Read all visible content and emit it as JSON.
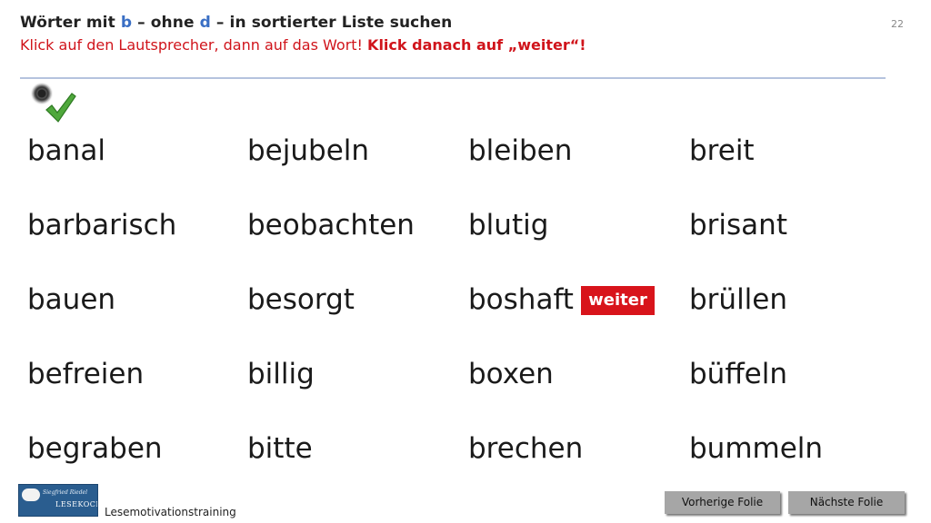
{
  "header": {
    "title_1": "Wörter mit ",
    "title_b": "b",
    "title_2": " – ohne ",
    "title_d": "d",
    "title_3": " – in sortierter Liste suchen",
    "instruction": "Klick auf den Lautsprecher, dann auf das Wort! ",
    "instruction_bold": "Klick danach auf „weiter“!",
    "page_number": "22"
  },
  "icons": {
    "speaker": "speaker-icon",
    "check": "checkmark-icon"
  },
  "words": {
    "c1": [
      "banal",
      "barbarisch",
      "bauen",
      "befreien",
      "begraben"
    ],
    "c2": [
      "bejubeln",
      "beobachten",
      "besorgt",
      "billig",
      "bitte"
    ],
    "c3": [
      "bleiben",
      "blutig",
      "boshaft",
      "boxen",
      "brechen"
    ],
    "c4": [
      "breit",
      "brisant",
      "brüllen",
      "büffeln",
      "bummeln"
    ]
  },
  "weiter_label": "weiter",
  "footer": {
    "logo_line1": "Siegfried Riedel",
    "logo_line2": "LESEKOCH",
    "label": "Lesemotivationstraining",
    "prev_label": "Vorherige  Folie",
    "next_label": "Nächste  Folie"
  },
  "colors": {
    "title_blue": "#3a6fc4",
    "instruction_red": "#d0141b",
    "weiter_bg": "#d8141b",
    "nav_gray": "#a6a6a6"
  }
}
